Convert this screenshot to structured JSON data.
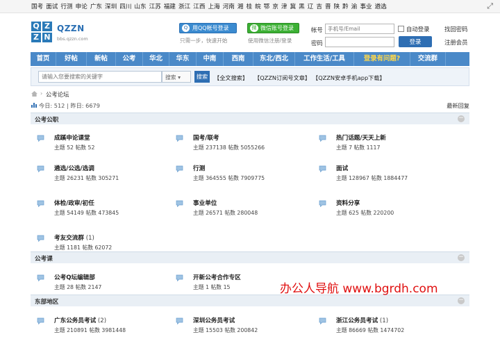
{
  "regions": [
    "国考",
    "面试",
    "行测",
    "申论",
    "广东",
    "深圳",
    "四川",
    "山东",
    "江苏",
    "福建",
    "浙江",
    "江西",
    "上海",
    "河南",
    "湘",
    "桂",
    "皖",
    "鄂",
    "京",
    "津",
    "冀",
    "黑",
    "辽",
    "吉",
    "晋",
    "陕",
    "黔",
    "渝",
    "事业",
    "遴选"
  ],
  "header": {
    "logo_text": "QZZN",
    "logo_letters": [
      "Q",
      "Z",
      "Z",
      "N"
    ],
    "logo_url": "bbs.qzzn.com",
    "qq_login": "用QQ帐号登录",
    "qq_icon": "Q",
    "qq_note": "只需一步，快速开始",
    "wechat_login": "微信账号登录",
    "wechat_icon": "微",
    "wechat_note": "使用微信注册/登录",
    "account_label": "帐号",
    "account_placeholder": "手机号/Email",
    "password_label": "密码",
    "auto_login": "自动登录",
    "login_button": "登录",
    "find_password": "找回密码",
    "register": "注册会员"
  },
  "nav": [
    "首页",
    "好帖",
    "新帖",
    "公考",
    "华北",
    "华东",
    "中南",
    "西南",
    "东北/西北",
    "工作生活/工具",
    "登录有问题?",
    "交流群"
  ],
  "search": {
    "placeholder": "请输入您要搜索的关键字",
    "scope": "搜索 ▾",
    "button": "搜索",
    "links": [
      "【全文搜索】",
      "【QZZN订阅号文章】",
      "【QZZN安卓手机app下载】"
    ]
  },
  "breadcrumb": {
    "separator": "›",
    "current": "公考论坛"
  },
  "stats": {
    "today_label": "今日:",
    "today": "512",
    "yesterday_label": "昨日:",
    "yesterday": "6679",
    "latest": "最新回复"
  },
  "sections": [
    {
      "title": "公考公职",
      "toggle": "−",
      "forums": [
        {
          "name": "成蹊申论课堂",
          "count": "",
          "stats": "主题 52  帖数 52"
        },
        {
          "name": "国考/联考",
          "count": "",
          "stats": "主题 237138  帖数 5055266"
        },
        {
          "name": "热门话题/天天上新",
          "count": "",
          "stats": "主题 7  帖数 1117"
        },
        {
          "name": "遴选/公选/选调",
          "count": "",
          "stats": "主题 26231  帖数 305271"
        },
        {
          "name": "行测",
          "count": "",
          "stats": "主题 364555  帖数 7909775"
        },
        {
          "name": "面试",
          "count": "",
          "stats": "主题 128967  帖数 1884477"
        },
        {
          "name": "体检/政审/初任",
          "count": "",
          "stats": "主题 54149  帖数 473845"
        },
        {
          "name": "事业单位",
          "count": "",
          "stats": "主题 26571  帖数 280048"
        },
        {
          "name": "资料分享",
          "count": "",
          "stats": "主题 625  帖数 220200"
        },
        {
          "name": "考友交流群",
          "count": " (1)",
          "stats": "主题 1181  帖数 62072"
        }
      ]
    },
    {
      "title": "公考课",
      "toggle": "−",
      "forums": [
        {
          "name": "公考Q坛编辑部",
          "count": "",
          "stats": "主题 28  帖数 2147"
        },
        {
          "name": "开新公考合作专区",
          "count": "",
          "stats": "主题 1  帖数 15"
        }
      ]
    },
    {
      "title": "东部地区",
      "toggle": "−",
      "forums": [
        {
          "name": "广东公务员考试",
          "count": " (2)",
          "stats": "主题 210891  帖数 3981448"
        },
        {
          "name": "深圳公务员考试",
          "count": "",
          "stats": "主题 15503  帖数 200842"
        },
        {
          "name": "浙江公务员考试",
          "count": " (1)",
          "stats": "主题 86669  帖数 1474702"
        }
      ]
    }
  ],
  "watermark": "办公人导航 www.bgrdh.com",
  "colors": {
    "nav": "#4a89c8",
    "accent": "#2e6eb3",
    "qq": "#3b8bd0",
    "wechat": "#3cb034",
    "watermark": "#e01010"
  }
}
